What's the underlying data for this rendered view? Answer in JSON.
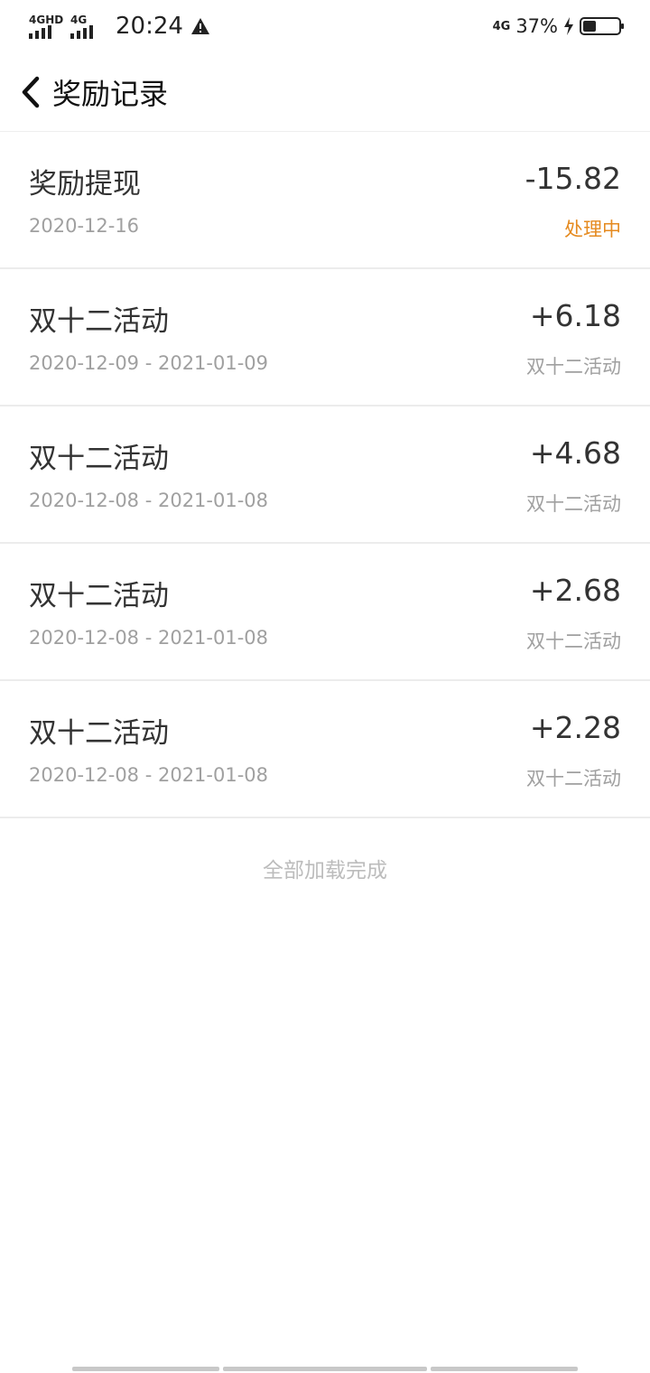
{
  "status_bar": {
    "net1_label": "4GHD",
    "net2_label": "4G",
    "time": "20:24",
    "right_net_label": "4G",
    "battery_percent": "37%",
    "battery_level": 0.37,
    "charging": true
  },
  "header": {
    "title": "奖励记录"
  },
  "records": [
    {
      "name": "奖励提现",
      "amount": "-15.82",
      "date": "2020-12-16",
      "tag": "处理中"
    },
    {
      "name": "双十二活动",
      "amount": "+6.18",
      "date": "2020-12-09 - 2021-01-09",
      "tag": "双十二活动"
    },
    {
      "name": "双十二活动",
      "amount": "+4.68",
      "date": "2020-12-08 - 2021-01-08",
      "tag": "双十二活动"
    },
    {
      "name": "双十二活动",
      "amount": "+2.68",
      "date": "2020-12-08 - 2021-01-08",
      "tag": "双十二活动"
    },
    {
      "name": "双十二活动",
      "amount": "+2.28",
      "date": "2020-12-08 - 2021-01-08",
      "tag": "双十二活动"
    }
  ],
  "footer": {
    "note": "全部加载完成"
  },
  "colors": {
    "processing": "#e58a1f",
    "muted": "#a0a0a0"
  }
}
